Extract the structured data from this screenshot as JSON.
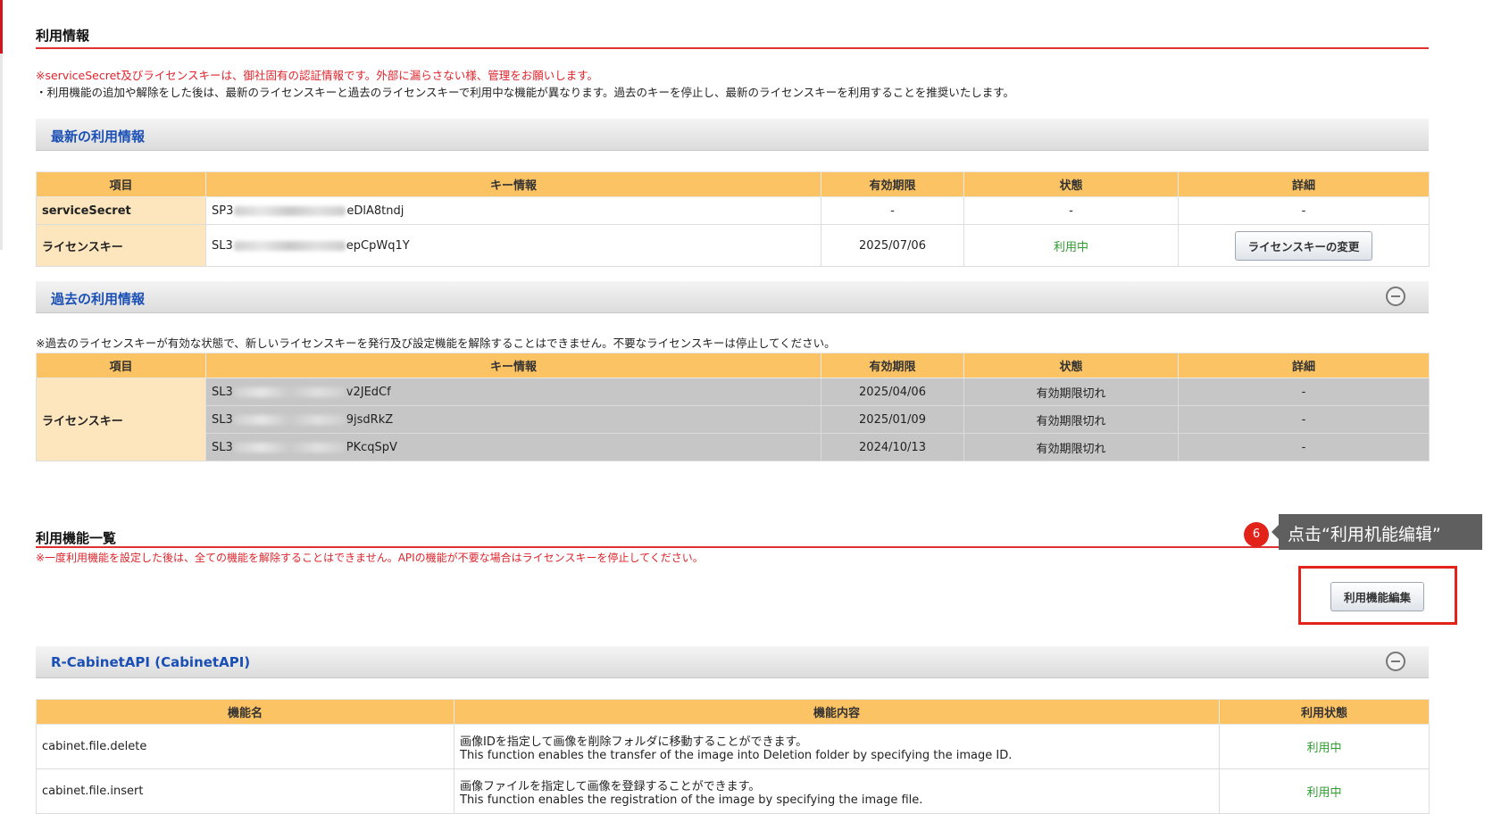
{
  "usage_info": {
    "title": "利用情報",
    "note_red": "※serviceSecret及びライセンスキーは、御社固有の認証情報です。外部に漏らさない様、管理をお願いします。",
    "note_black": "・利用機能の追加や解除をした後は、最新のライセンスキーと過去のライセンスキーで利用中な機能が異なります。過去のキーを停止し、最新のライセンスキーを利用することを推奨いたします。"
  },
  "latest": {
    "title": "最新の利用情報",
    "headers": [
      "項目",
      "キー情報",
      "有効期限",
      "状態",
      "詳細"
    ],
    "rows": [
      {
        "item": "serviceSecret",
        "key_prefix": "SP3",
        "key_suffix": "eDlA8tndj",
        "expiry": "-",
        "status": "-",
        "detail": "-"
      },
      {
        "item": "ライセンスキー",
        "key_prefix": "SL3",
        "key_suffix": "epCpWq1Y",
        "expiry": "2025/07/06",
        "status": "利用中",
        "detail_button": "ライセンスキーの変更"
      }
    ]
  },
  "past": {
    "title": "過去の利用情報",
    "note": "※過去のライセンスキーが有効な状態で、新しいライセンスキーを発行及び設定機能を解除することはできません。不要なライセンスキーは停止してください。",
    "headers": [
      "項目",
      "キー情報",
      "有効期限",
      "状態",
      "詳細"
    ],
    "item": "ライセンスキー",
    "rows": [
      {
        "key_prefix": "SL3",
        "key_suffix": "v2JEdCf",
        "expiry": "2025/04/06",
        "status": "有効期限切れ",
        "detail": "-"
      },
      {
        "key_prefix": "SL3",
        "key_suffix": "9jsdRkZ",
        "expiry": "2025/01/09",
        "status": "有効期限切れ",
        "detail": "-"
      },
      {
        "key_prefix": "SL3",
        "key_suffix": "PKcqSpV",
        "expiry": "2024/10/13",
        "status": "有効期限切れ",
        "detail": "-"
      }
    ]
  },
  "features": {
    "title": "利用機能一覧",
    "note_red": "※一度利用機能を設定した後は、全ての機能を解除することはできません。APIの機能が不要な場合はライセンスキーを停止してください。",
    "edit_button": "利用機能編集"
  },
  "annotation": {
    "step": "6",
    "text": "点击“利用机能编辑”"
  },
  "cabinet": {
    "title": "R-CabinetAPI (CabinetAPI)",
    "headers": [
      "機能名",
      "機能内容",
      "利用状態"
    ],
    "rows": [
      {
        "name": "cabinet.file.delete",
        "desc_ja": "画像IDを指定して画像を削除フォルダに移動することができます。",
        "desc_en": "This function enables the transfer of the image into Deletion folder by specifying the image ID.",
        "status": "利用中"
      },
      {
        "name": "cabinet.file.insert",
        "desc_ja": "画像ファイルを指定して画像を登録することができます。",
        "desc_en": "This function enables the registration of the image by specifying the image file.",
        "status": "利用中"
      }
    ]
  },
  "colors": {
    "accent_red": "#e03030",
    "table_header": "#fbc363",
    "item_cell": "#fde6bd",
    "panel_title": "#1a4fb5",
    "status_green": "#2f9e2f"
  }
}
